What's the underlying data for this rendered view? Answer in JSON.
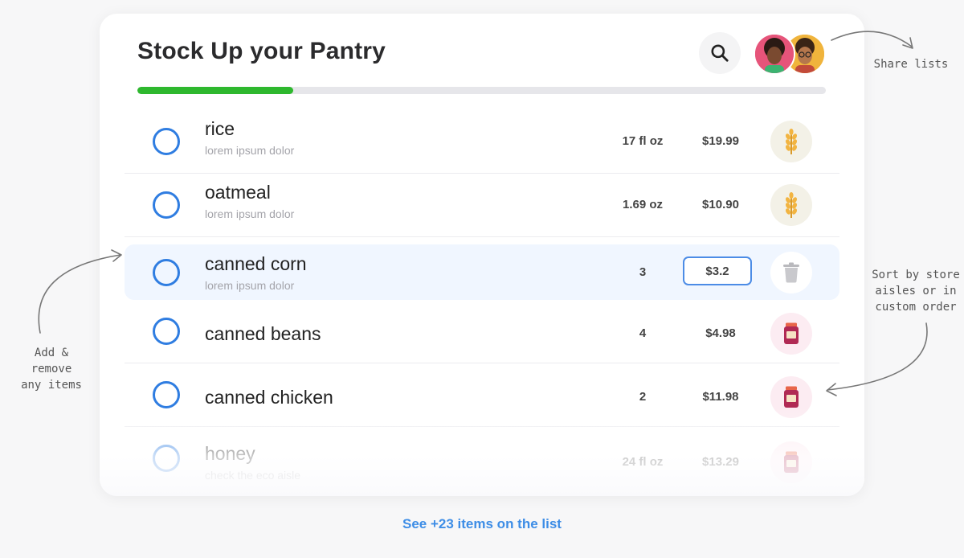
{
  "header": {
    "title": "Stock Up your Pantry",
    "progress_fraction": 0.226
  },
  "items": [
    {
      "name": "rice",
      "subtitle": "lorem ipsum dolor",
      "qty": "17 fl oz",
      "price": "$19.99",
      "icon": "wheat-icon"
    },
    {
      "name": "oatmeal",
      "subtitle": "lorem ipsum dolor",
      "qty": "1.69 oz",
      "price": "$10.90",
      "icon": "wheat-icon"
    },
    {
      "name": "canned corn",
      "subtitle": "lorem ipsum dolor",
      "qty": "3",
      "price_input": "$3.2",
      "icon": "trash-icon"
    },
    {
      "name": "canned beans",
      "qty": "4",
      "price": "$4.98",
      "icon": "jar-icon"
    },
    {
      "name": "canned chicken",
      "qty": "2",
      "price": "$11.98",
      "icon": "jar-icon"
    },
    {
      "name": "honey",
      "subtitle": "check the eco aisle",
      "qty": "24 fl oz",
      "price": "$13.29",
      "icon": "jar-icon"
    }
  ],
  "footer": {
    "see_more": "See +23 items on the list"
  },
  "annotations": {
    "share": "Share lists",
    "sort_line1": "Sort by store",
    "sort_line2": "aisles or in",
    "sort_line3": "custom order",
    "add_line1": "Add &",
    "add_line2": "remove",
    "add_line3": "any items"
  },
  "colors": {
    "accent_blue": "#2f7de1",
    "progress_green": "#2eb82e",
    "link_blue": "#3d8de6"
  }
}
